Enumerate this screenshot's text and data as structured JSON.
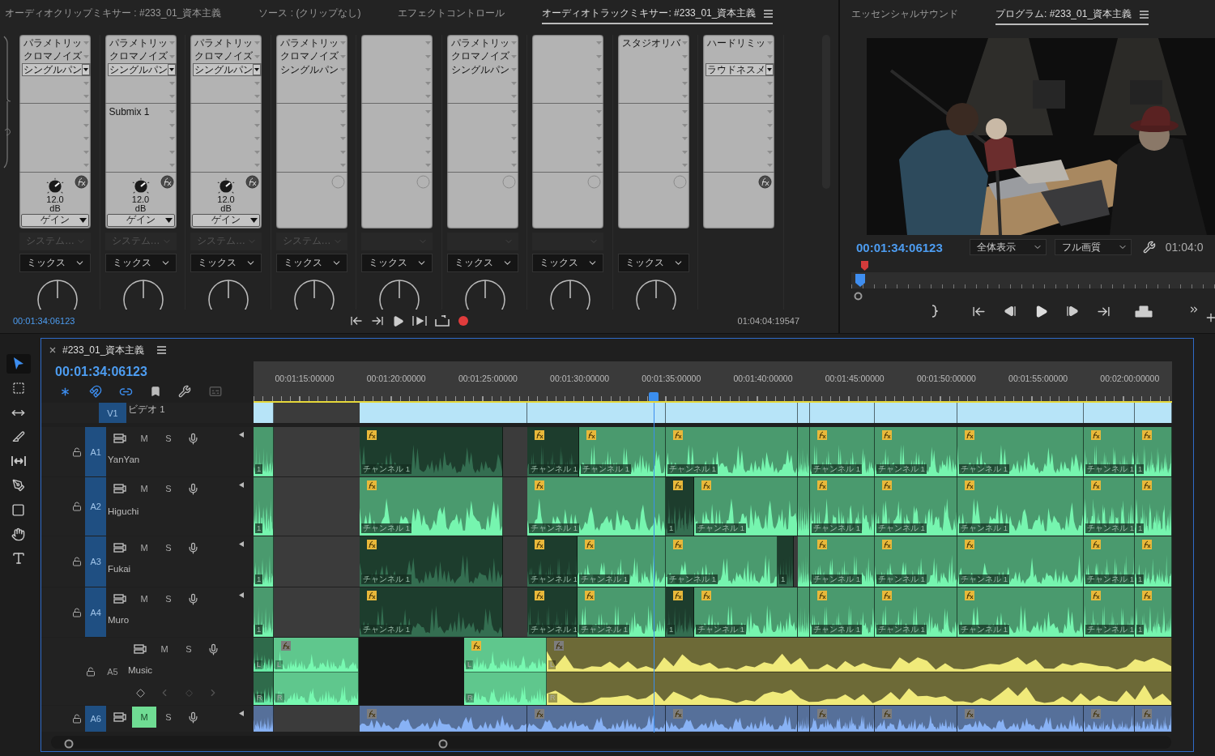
{
  "mixer": {
    "tabs": [
      {
        "label": "オーディオクリップミキサー : #233_01_資本主義",
        "selected": false
      },
      {
        "label": "ソース : (クリップなし)",
        "selected": false
      },
      {
        "label": "エフェクトコントロール",
        "selected": false
      },
      {
        "label": "オーディオトラックミキサー: #233_01_資本主義",
        "selected": true
      }
    ],
    "channels": [
      {
        "kind": "audio",
        "effects": [
          {
            "kind": "effect",
            "name": "パラメトリッ",
            "selected": false
          },
          {
            "kind": "effect",
            "name": "クロマノイズ",
            "selected": false
          },
          {
            "kind": "effect",
            "name": "シングルパン",
            "selected": true
          }
        ],
        "fx_active": true,
        "gain": {
          "value": "12.0",
          "unit": "dB",
          "mode": "ゲイン"
        },
        "output": {
          "label": "システム…",
          "disabled": true
        },
        "automation": "ミックス"
      },
      {
        "kind": "audio",
        "effects": [
          {
            "kind": "effect",
            "name": "パラメトリッ",
            "selected": false
          },
          {
            "kind": "effect",
            "name": "クロマノイズ",
            "selected": false
          },
          {
            "kind": "effect",
            "name": "シングルパン",
            "selected": true
          }
        ],
        "sends": [
          {
            "name": "Submix 1"
          }
        ],
        "fx_active": true,
        "gain": {
          "value": "12.0",
          "unit": "dB",
          "mode": "ゲイン"
        },
        "output": {
          "label": "システム…",
          "disabled": true
        },
        "automation": "ミックス"
      },
      {
        "kind": "audio",
        "effects": [
          {
            "kind": "effect",
            "name": "パラメトリッ",
            "selected": false
          },
          {
            "kind": "effect",
            "name": "クロマノイズ",
            "selected": false
          },
          {
            "kind": "effect",
            "name": "シングルパン",
            "selected": true
          }
        ],
        "fx_active": true,
        "gain": {
          "value": "12.0",
          "unit": "dB",
          "mode": "ゲイン"
        },
        "output": {
          "label": "システム…",
          "disabled": true
        },
        "automation": "ミックス"
      },
      {
        "kind": "audio",
        "effects": [
          {
            "kind": "effect",
            "name": "パラメトリッ",
            "selected": false
          },
          {
            "kind": "effect",
            "name": "クロマノイズ",
            "selected": false
          },
          {
            "kind": "effect",
            "name": "シングルパン",
            "selected": false
          }
        ],
        "fx_active": false,
        "output": {
          "label": "システム…",
          "disabled": true
        },
        "automation": "ミックス"
      },
      {
        "kind": "audio",
        "fx_active": false,
        "output": {
          "disabled": true
        },
        "automation": "ミックス"
      },
      {
        "kind": "audio",
        "effects": [
          {
            "kind": "effect",
            "name": "パラメトリッ",
            "selected": false
          },
          {
            "kind": "effect",
            "name": "クロマノイズ",
            "selected": false
          },
          {
            "kind": "effect",
            "name": "シングルパン",
            "selected": false
          }
        ],
        "fx_active": false,
        "output": {
          "disabled": true
        },
        "automation": "ミックス"
      },
      {
        "kind": "audio",
        "fx_active": false,
        "output": {
          "disabled": true
        },
        "automation": "ミックス"
      },
      {
        "kind": "audio",
        "effects": [
          {
            "kind": "effect",
            "name": "スタジオリバ",
            "selected": false
          }
        ],
        "fx_active": false,
        "automation": "ミックス"
      },
      {
        "kind": "master",
        "effects": [
          {
            "kind": "effect",
            "name": "ハードリミッ",
            "selected": false
          },
          {
            "kind": "empty"
          },
          {
            "kind": "effect",
            "name": "ラウドネスメ",
            "selected": true
          }
        ],
        "fx_active": true
      }
    ],
    "timecode": "00:01:34:06123",
    "duration": "01:04:04:19547"
  },
  "program": {
    "tabs": [
      {
        "label": "エッセンシャルサウンド",
        "selected": false
      },
      {
        "label": "プログラム: #233_01_資本主義",
        "selected": true
      }
    ],
    "timecode": "00:01:34:06123",
    "zoom": "全体表示",
    "quality": "フル画質",
    "duration": "01:04:0"
  },
  "tools": [
    {
      "kind": "selection",
      "selected": true
    },
    {
      "kind": "track-select",
      "selected": false
    },
    {
      "kind": "ripple",
      "selected": false
    },
    {
      "kind": "razor",
      "selected": false
    },
    {
      "kind": "slip",
      "selected": false
    },
    {
      "kind": "pen",
      "selected": false
    },
    {
      "kind": "rectangle",
      "selected": false
    },
    {
      "kind": "hand",
      "selected": false
    },
    {
      "kind": "type",
      "selected": false
    }
  ],
  "timeline": {
    "title": "#233_01_資本主義",
    "timecode": "00:01:34:06123",
    "ruler": [
      "00:01:15:00000",
      "00:01:20:00000",
      "00:01:25:00000",
      "00:01:30:00000",
      "00:01:35:00000",
      "00:01:40:00000",
      "00:01:45:00000",
      "00:01:50:00000",
      "00:01:55:00000",
      "00:02:00:00000"
    ],
    "tracks": [
      {
        "kind": "video",
        "id_label": "V1",
        "name": "ビデオ 1",
        "targeted": true,
        "clips": [
          {
            "kind": "clip",
            "color": "#b7e4f8"
          },
          {
            "kind": "gap"
          },
          {
            "kind": "clip",
            "color": "#b7e4f8"
          },
          {
            "kind": "clip",
            "color": "#b7e4f8"
          },
          {
            "kind": "clip",
            "color": "#b7e4f8"
          },
          {
            "kind": "clip",
            "color": "#b7e4f8"
          },
          {
            "kind": "clip",
            "color": "#b7e4f8"
          },
          {
            "kind": "clip",
            "color": "#b7e4f8"
          },
          {
            "kind": "clip",
            "color": "#b7e4f8"
          },
          {
            "kind": "clip",
            "color": "#b7e4f8"
          },
          {
            "kind": "clip",
            "color": "#b7e4f8"
          }
        ]
      },
      {
        "kind": "audio",
        "id_label": "A1",
        "name": "YanYan",
        "targeted": true,
        "mute_label": "M",
        "muted": false,
        "solo_label": "S",
        "clips": [
          {
            "kind": "clip",
            "color": "#4a9a6e",
            "label": "1"
          },
          {
            "kind": "gap"
          },
          {
            "kind": "clip",
            "color": "#1d3d2d",
            "fx_enabled": true,
            "label": "チャンネル 1"
          },
          {
            "kind": "gap"
          },
          {
            "kind": "clip",
            "color": "#1d3d2d",
            "fx_enabled": true,
            "label": "チャンネル 1"
          },
          {
            "kind": "clip",
            "color": "#4a9a6e",
            "fx_enabled": true,
            "label": "チャンネル 1"
          },
          {
            "kind": "clip",
            "color": "#4a9a6e",
            "fx_enabled": true,
            "label": "チャンネル 1"
          },
          {
            "kind": "clip",
            "color": "#4a9a6e"
          },
          {
            "kind": "clip",
            "color": "#4a9a6e",
            "fx_enabled": true,
            "label": "チャンネル 1"
          },
          {
            "kind": "clip",
            "color": "#4a9a6e",
            "fx_enabled": true,
            "label": "チャンネル 1"
          },
          {
            "kind": "clip",
            "color": "#4a9a6e",
            "fx_enabled": true,
            "label": "チャンネル 1"
          },
          {
            "kind": "clip",
            "color": "#4a9a6e",
            "fx_enabled": true,
            "label": "チャンネル 1"
          },
          {
            "kind": "clip",
            "color": "#4a9a6e",
            "fx_enabled": true,
            "label": "1"
          }
        ]
      },
      {
        "kind": "audio",
        "id_label": "A2",
        "name": "Higuchi",
        "targeted": true,
        "mute_label": "M",
        "muted": false,
        "solo_label": "S",
        "clips": [
          {
            "kind": "clip",
            "color": "#4a9a6e",
            "label": "1"
          },
          {
            "kind": "gap"
          },
          {
            "kind": "clip",
            "color": "#4a9a6e",
            "fx_enabled": true,
            "label": "チャンネル 1"
          },
          {
            "kind": "gap"
          },
          {
            "kind": "clip",
            "color": "#4a9a6e",
            "fx_enabled": true,
            "label": "チャンネル 1"
          },
          {
            "kind": "clip",
            "color": "#1d3d2d",
            "fx_enabled": true,
            "label": "1"
          },
          {
            "kind": "clip",
            "color": "#4a9a6e",
            "fx_enabled": true,
            "label": "チャンネル 1"
          },
          {
            "kind": "clip",
            "color": "#4a9a6e"
          },
          {
            "kind": "clip",
            "color": "#4a9a6e",
            "fx_enabled": true,
            "label": "チャンネル 1"
          },
          {
            "kind": "clip",
            "color": "#4a9a6e",
            "fx_enabled": true,
            "label": "チャンネル 1"
          },
          {
            "kind": "clip",
            "color": "#4a9a6e",
            "fx_enabled": true,
            "label": "チャンネル 1"
          },
          {
            "kind": "clip",
            "color": "#4a9a6e",
            "fx_enabled": true,
            "label": "チャンネル 1"
          },
          {
            "kind": "clip",
            "color": "#4a9a6e",
            "fx_enabled": true,
            "label": "1"
          }
        ]
      },
      {
        "kind": "audio",
        "id_label": "A3",
        "name": "Fukai",
        "targeted": true,
        "mute_label": "M",
        "muted": false,
        "solo_label": "S",
        "clips": [
          {
            "kind": "clip",
            "color": "#4a9a6e",
            "label": "1"
          },
          {
            "kind": "gap"
          },
          {
            "kind": "clip",
            "color": "#1d3d2d",
            "fx_enabled": true,
            "label": "チャンネル 1"
          },
          {
            "kind": "gap"
          },
          {
            "kind": "clip",
            "color": "#1d3d2d",
            "fx_enabled": true,
            "label": "チャンネル 1"
          },
          {
            "kind": "clip",
            "color": "#4a9a6e",
            "fx_enabled": true,
            "label": "チャンネル 1"
          },
          {
            "kind": "clip",
            "color": "#4a9a6e",
            "fx_enabled": true,
            "label": "チャンネル 1"
          },
          {
            "kind": "clip",
            "color": "#1d3d2d",
            "label": "1"
          },
          {
            "kind": "gap"
          },
          {
            "kind": "clip",
            "color": "#4a9a6e"
          },
          {
            "kind": "clip",
            "color": "#4a9a6e",
            "fx_enabled": true,
            "label": "チャンネル 1"
          },
          {
            "kind": "clip",
            "color": "#4a9a6e",
            "fx_enabled": true,
            "label": "チャンネル 1"
          },
          {
            "kind": "clip",
            "color": "#4a9a6e",
            "fx_enabled": true,
            "label": "チャンネル 1"
          },
          {
            "kind": "clip",
            "color": "#4a9a6e",
            "fx_enabled": true,
            "label": "チャンネル 1"
          },
          {
            "kind": "clip",
            "color": "#4a9a6e",
            "fx_enabled": true,
            "label": "1"
          }
        ]
      },
      {
        "kind": "audio",
        "id_label": "A4",
        "name": "Muro",
        "targeted": true,
        "mute_label": "M",
        "muted": false,
        "solo_label": "S",
        "clips": [
          {
            "kind": "clip",
            "color": "#4a9a6e",
            "label": "1"
          },
          {
            "kind": "gap"
          },
          {
            "kind": "clip",
            "color": "#1d3d2d",
            "fx_enabled": true,
            "label": "チャンネル 1"
          },
          {
            "kind": "gap"
          },
          {
            "kind": "clip",
            "color": "#1d3d2d",
            "fx_enabled": true,
            "label": "チャンネル 1"
          },
          {
            "kind": "clip",
            "color": "#4a9a6e",
            "fx_enabled": true,
            "label": "チャンネル 1"
          },
          {
            "kind": "clip",
            "color": "#1d3d2d",
            "fx_enabled": true,
            "label": "1"
          },
          {
            "kind": "clip",
            "color": "#4a9a6e",
            "fx_enabled": true,
            "label": "チャンネル 1"
          },
          {
            "kind": "clip",
            "color": "#4a9a6e"
          },
          {
            "kind": "clip",
            "color": "#4a9a6e",
            "fx_enabled": true,
            "label": "チャンネル 1"
          },
          {
            "kind": "clip",
            "color": "#4a9a6e",
            "fx_enabled": true,
            "label": "チャンネル 1"
          },
          {
            "kind": "clip",
            "color": "#4a9a6e",
            "fx_enabled": true,
            "label": "チャンネル 1"
          },
          {
            "kind": "clip",
            "color": "#4a9a6e",
            "fx_enabled": true,
            "label": "チャンネル 1"
          },
          {
            "kind": "clip",
            "color": "#4a9a6e",
            "fx_enabled": true,
            "label": "1"
          }
        ]
      },
      {
        "kind": "stereo",
        "id_label": "A5",
        "name": "Music",
        "targeted": false,
        "mute_label": "M",
        "muted": false,
        "solo_label": "S",
        "clips": [
          {
            "kind": "clip",
            "color": "#2f6b4b",
            "channels": [
              "L",
              "R"
            ]
          },
          {
            "kind": "clip",
            "color": "#5fc78d",
            "fx_enabled": false,
            "channels": [
              "L",
              "R"
            ]
          },
          {
            "kind": "empty"
          },
          {
            "kind": "clip",
            "color": "#5fc78d",
            "fx_enabled": true,
            "channels": [
              "L",
              "R"
            ]
          },
          {
            "kind": "clip",
            "color": "#6d6a37",
            "fx_enabled": false,
            "channels": [
              "L",
              "R"
            ]
          }
        ]
      },
      {
        "kind": "audio",
        "id_label": "A6",
        "targeted": true,
        "mute_label": "M",
        "muted": true,
        "solo_label": "S",
        "clips": [
          {
            "kind": "clip",
            "color": "#56709a"
          },
          {
            "kind": "gap"
          },
          {
            "kind": "clip",
            "color": "#56709a",
            "fx_enabled": false
          },
          {
            "kind": "clip",
            "color": "#56709a",
            "fx_enabled": false
          },
          {
            "kind": "clip",
            "color": "#56709a",
            "fx_enabled": false
          },
          {
            "kind": "clip",
            "color": "#56709a"
          },
          {
            "kind": "clip",
            "color": "#56709a",
            "fx_enabled": false
          },
          {
            "kind": "clip",
            "color": "#56709a",
            "fx_enabled": false
          },
          {
            "kind": "clip",
            "color": "#56709a",
            "fx_enabled": false
          },
          {
            "kind": "clip",
            "color": "#56709a",
            "fx_enabled": false
          },
          {
            "kind": "clip",
            "color": "#56709a",
            "fx_enabled": false
          }
        ]
      }
    ]
  }
}
